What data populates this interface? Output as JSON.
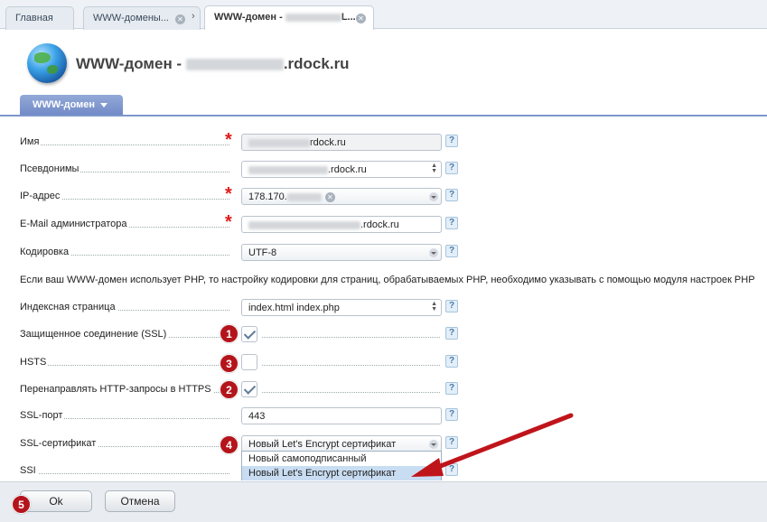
{
  "tabs": {
    "home": "Главная",
    "domains": "WWW-домены...",
    "domain_prefix": "WWW-домен -",
    "domain_suffix": "L..."
  },
  "header": {
    "title_prefix": "WWW-домен -",
    "title_suffix": ".rdock.ru"
  },
  "section": {
    "tab_label": "WWW-домен"
  },
  "form": {
    "name": {
      "label": "Имя",
      "value_suffix": "rdock.ru"
    },
    "aliases": {
      "label": "Псевдонимы",
      "value_suffix": ".rdock.ru"
    },
    "ip": {
      "label": "IP-адрес",
      "value": "178.170."
    },
    "email": {
      "label": "E-Mail администратора",
      "value_suffix": ".rdock.ru"
    },
    "encoding": {
      "label": "Кодировка",
      "value": "UTF-8"
    },
    "note": "Если ваш WWW-домен использует PHP, то настройку кодировки для страниц, обрабатываемых PHP, необходимо указывать с помощью модуля настроек PHP",
    "index": {
      "label": "Индексная страница",
      "value": "index.html index.php"
    },
    "ssl": {
      "label": "Защищенное соединение (SSL)",
      "checked": true
    },
    "hsts": {
      "label": "HSTS",
      "checked": false
    },
    "redirect": {
      "label": "Перенаправлять HTTP-запросы в HTTPS",
      "checked": true
    },
    "ssl_port": {
      "label": "SSL-порт",
      "value": "443"
    },
    "ssl_cert": {
      "label": "SSL-сертификат",
      "value": "Новый Let's Encrypt сертификат",
      "options": [
        "Новый самоподписанный",
        "Новый Let's Encrypt сертификат"
      ]
    },
    "ssi": {
      "label": "SSI"
    },
    "help_glyph": "?"
  },
  "badges": {
    "b1": "1",
    "b2": "2",
    "b3": "3",
    "b4": "4",
    "b5": "5"
  },
  "buttons": {
    "ok": "Ok",
    "cancel": "Отмена"
  },
  "colors": {
    "accent": "#7d97cc",
    "required": "#e01a1a",
    "badge": "#b4141b",
    "arrow": "#c0141b"
  }
}
